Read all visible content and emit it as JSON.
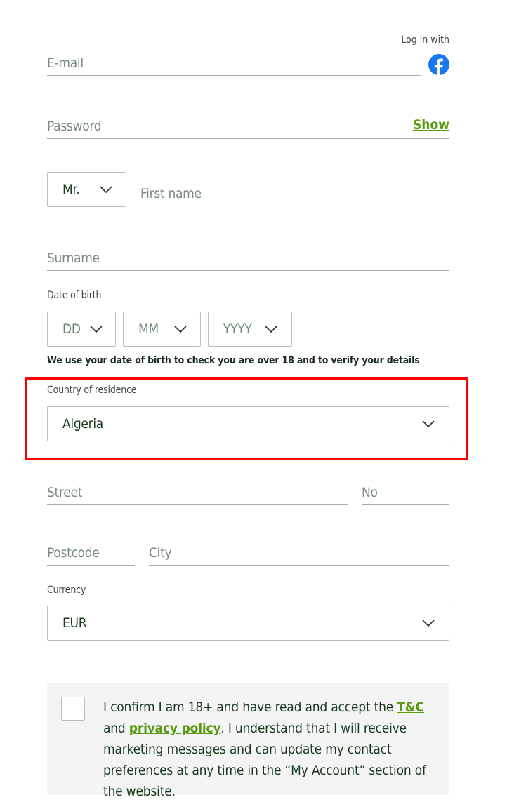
{
  "login": {
    "log_in_with_label": "Log in with",
    "facebook_icon": "facebook-icon",
    "facebook_color": "#1877f2"
  },
  "fields": {
    "email_placeholder": "E-mail",
    "password_placeholder": "Password",
    "show_label": "Show",
    "title_value": "Mr.",
    "first_name_placeholder": "First name",
    "surname_placeholder": "Surname",
    "dob_label": "Date of birth",
    "dob_day": "DD",
    "dob_month": "MM",
    "dob_year": "YYYY",
    "dob_hint": "We use your date of birth to check you are over 18 and to verify your details",
    "country_label": "Country of residence",
    "country_value": "Algeria",
    "street_placeholder": "Street",
    "number_placeholder": "No",
    "postcode_placeholder": "Postcode",
    "city_placeholder": "City",
    "currency_label": "Currency",
    "currency_value": "EUR"
  },
  "terms": {
    "text_1": "I confirm I am 18+ and have read and accept the ",
    "tc_link": "T&C",
    "text_2": " and ",
    "privacy_link": "privacy policy",
    "text_3": ". I understand that I will receive marketing messages and can update my contact preferences at any time in the “My Account” section of the website."
  },
  "colors": {
    "accent_green": "#5a9a12",
    "highlight_red": "#ff0000",
    "text_dark_green": "#1a3a1f"
  }
}
